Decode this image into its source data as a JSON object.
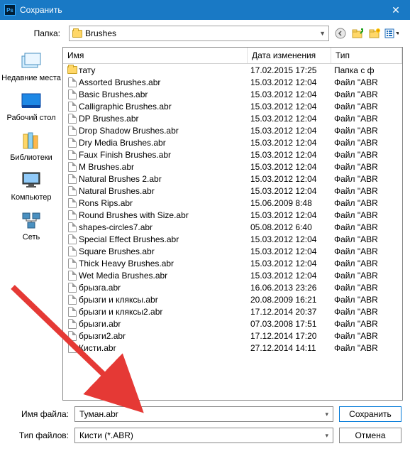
{
  "window": {
    "title": "Сохранить",
    "close": "✕"
  },
  "folder": {
    "label": "Папка:",
    "value": "Brushes"
  },
  "places": {
    "recent": "Недавние места",
    "desktop": "Рабочий стол",
    "libraries": "Библиотеки",
    "computer": "Компьютер",
    "network": "Сеть"
  },
  "columns": {
    "name": "Имя",
    "date": "Дата изменения",
    "type": "Тип"
  },
  "files": [
    {
      "name": "тату",
      "date": "17.02.2015 17:25",
      "type": "Папка с ф",
      "folder": true
    },
    {
      "name": "Assorted Brushes.abr",
      "date": "15.03.2012 12:04",
      "type": "Файл \"ABR"
    },
    {
      "name": "Basic Brushes.abr",
      "date": "15.03.2012 12:04",
      "type": "Файл \"ABR"
    },
    {
      "name": "Calligraphic Brushes.abr",
      "date": "15.03.2012 12:04",
      "type": "Файл \"ABR"
    },
    {
      "name": "DP Brushes.abr",
      "date": "15.03.2012 12:04",
      "type": "Файл \"ABR"
    },
    {
      "name": "Drop Shadow Brushes.abr",
      "date": "15.03.2012 12:04",
      "type": "Файл \"ABR"
    },
    {
      "name": "Dry Media Brushes.abr",
      "date": "15.03.2012 12:04",
      "type": "Файл \"ABR"
    },
    {
      "name": "Faux Finish Brushes.abr",
      "date": "15.03.2012 12:04",
      "type": "Файл \"ABR"
    },
    {
      "name": "M Brushes.abr",
      "date": "15.03.2012 12:04",
      "type": "Файл \"ABR"
    },
    {
      "name": "Natural Brushes 2.abr",
      "date": "15.03.2012 12:04",
      "type": "Файл \"ABR"
    },
    {
      "name": "Natural Brushes.abr",
      "date": "15.03.2012 12:04",
      "type": "Файл \"ABR"
    },
    {
      "name": "Rons Rips.abr",
      "date": "15.06.2009 8:48",
      "type": "Файл \"ABR"
    },
    {
      "name": "Round Brushes with Size.abr",
      "date": "15.03.2012 12:04",
      "type": "Файл \"ABR"
    },
    {
      "name": "shapes-circles7.abr",
      "date": "05.08.2012 6:40",
      "type": "Файл \"ABR"
    },
    {
      "name": "Special Effect Brushes.abr",
      "date": "15.03.2012 12:04",
      "type": "Файл \"ABR"
    },
    {
      "name": "Square Brushes.abr",
      "date": "15.03.2012 12:04",
      "type": "Файл \"ABR"
    },
    {
      "name": "Thick Heavy Brushes.abr",
      "date": "15.03.2012 12:04",
      "type": "Файл \"ABR"
    },
    {
      "name": "Wet Media Brushes.abr",
      "date": "15.03.2012 12:04",
      "type": "Файл \"ABR"
    },
    {
      "name": "брызга.abr",
      "date": "16.06.2013 23:26",
      "type": "Файл \"ABR"
    },
    {
      "name": "брызги и кляксы.abr",
      "date": "20.08.2009 16:21",
      "type": "Файл \"ABR"
    },
    {
      "name": "брызги и кляксы2.abr",
      "date": "17.12.2014 20:37",
      "type": "Файл \"ABR"
    },
    {
      "name": "брызги.abr",
      "date": "07.03.2008 17:51",
      "type": "Файл \"ABR"
    },
    {
      "name": "брызги2.abr",
      "date": "17.12.2014 17:20",
      "type": "Файл \"ABR"
    },
    {
      "name": "Кисти.abr",
      "date": "27.12.2014 14:11",
      "type": "Файл \"ABR"
    }
  ],
  "filename": {
    "label": "Имя файла:",
    "value": "Туман.abr"
  },
  "filetype": {
    "label": "Тип файлов:",
    "value": "Кисти (*.ABR)"
  },
  "buttons": {
    "save": "Сохранить",
    "cancel": "Отмена"
  },
  "toolbar": {
    "back": "back",
    "up": "up",
    "newfolder": "newfolder",
    "views": "views"
  }
}
